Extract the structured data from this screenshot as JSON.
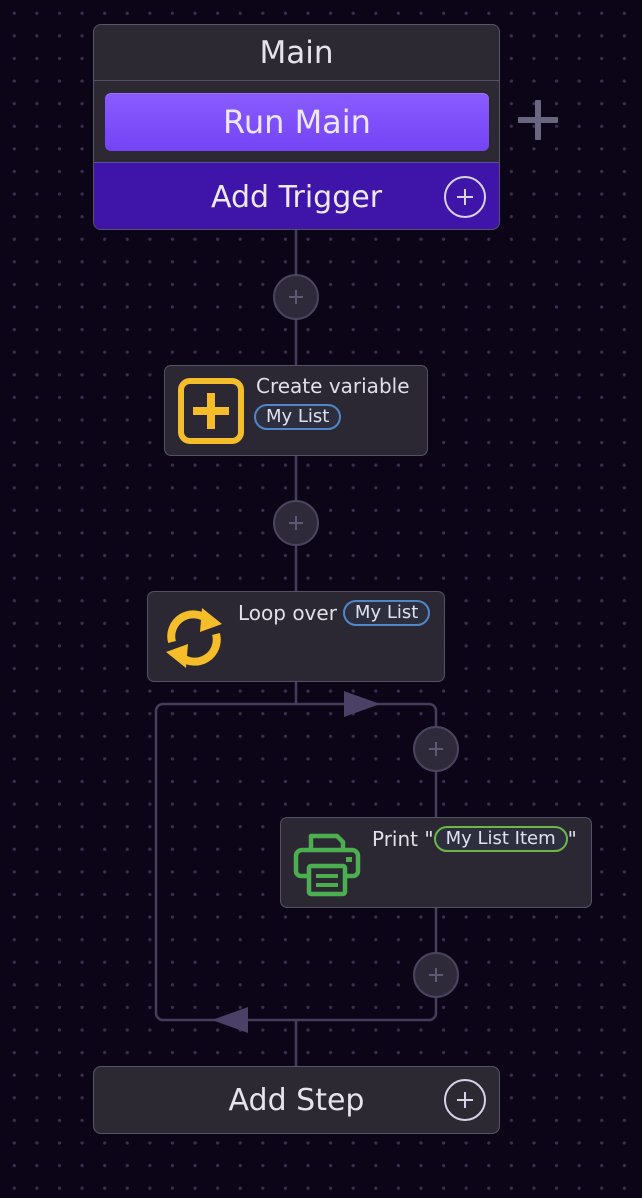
{
  "main": {
    "title": "Main",
    "run_label": "Run Main",
    "add_trigger_label": "Add Trigger"
  },
  "steps": [
    {
      "name": "Create variable",
      "icon": "create-variable-icon",
      "variable": "My List",
      "pill_color": "#4f87c9"
    },
    {
      "prefix": "Loop over",
      "icon": "loop-icon",
      "variable": "My List",
      "pill_color": "#4f87c9"
    },
    {
      "prefix": "Print \"",
      "suffix": "\"",
      "icon": "printer-icon",
      "variable": "My List Item",
      "pill_color": "#6bb848"
    }
  ],
  "add_step_label": "Add Step",
  "colors": {
    "background": "#0c0518",
    "accent": "#7443f5",
    "trigger_bar": "#3e15a8",
    "icon_yellow": "#f6bd2b",
    "icon_green": "#4caf4f"
  }
}
